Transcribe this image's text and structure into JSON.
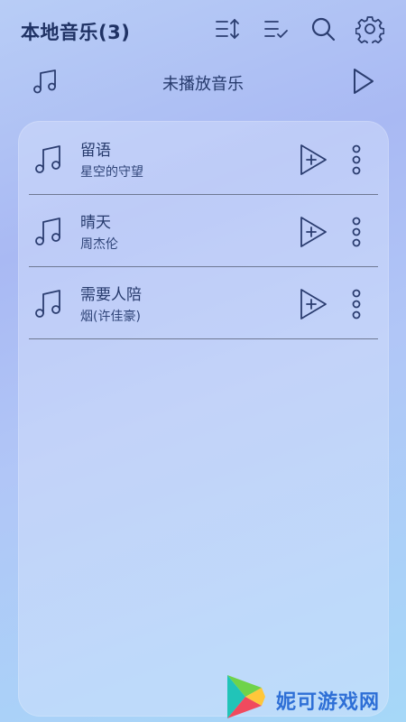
{
  "header": {
    "title": "本地音乐(3)",
    "icons": [
      "sort-icon",
      "multi-select-icon",
      "search-icon",
      "settings-icon"
    ]
  },
  "now_playing": {
    "label": "未播放音乐"
  },
  "songs": [
    {
      "title": "留语",
      "artist": "星空的守望"
    },
    {
      "title": "晴天",
      "artist": "周杰伦"
    },
    {
      "title": "需要人陪",
      "artist": "烟(许佳豪)"
    }
  ],
  "watermark": {
    "text": "妮可游戏网"
  },
  "colors": {
    "text_primary": "#263a6c",
    "icon_stroke": "#2b3d70",
    "accent_watermark": "#2e6fd6"
  }
}
